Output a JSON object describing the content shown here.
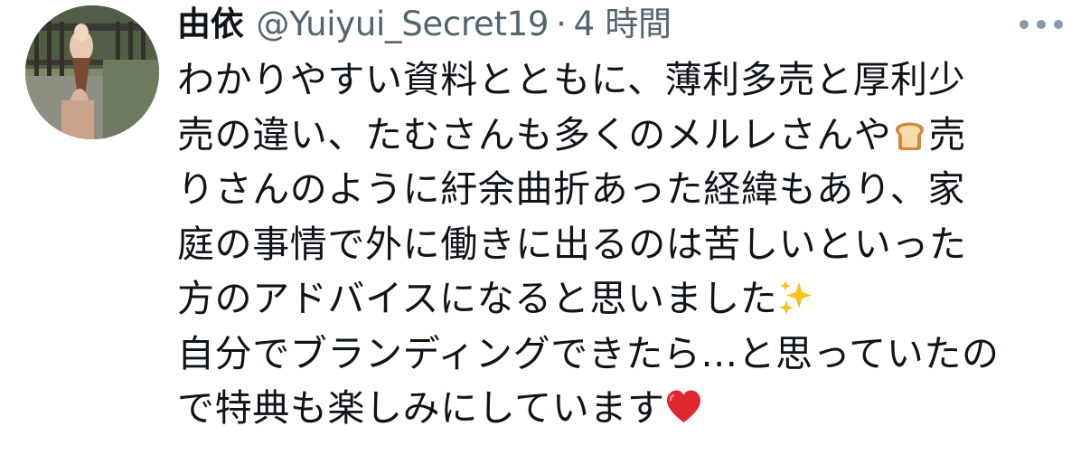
{
  "tweet": {
    "author": {
      "display_name": "由依",
      "handle": "@Yuiyui_Secret19"
    },
    "separator": "·",
    "timestamp": "4 時間",
    "lines": [
      {
        "text": "わかりやすい資料とともに、薄利多売と厚利少"
      },
      {
        "text": "売の違い、たむさんも多くのメルレさんや",
        "emoji": "bread-emoji",
        "after": "売"
      },
      {
        "text": "りさんのように紆余曲折あった経緯もあり、家"
      },
      {
        "text": "庭の事情で外に働きに出るのは苦しいといった"
      },
      {
        "text": "方のアドバイスになると思いました",
        "emoji": "sparkles-emoji",
        "after": ""
      },
      {
        "text": "自分でブランディングできたら...と思っていたの"
      },
      {
        "text": "で特典も楽しみにしています",
        "emoji": "red-heart-emoji",
        "after": ""
      }
    ]
  },
  "icons": {
    "more": "more-dots-icon",
    "avatar_photo": "soft-serve-ice-cream-photo"
  },
  "colors": {
    "text_primary": "#0f1419",
    "text_secondary": "#536471",
    "heart": "#e0262f",
    "sparkle": "#f5c518",
    "bread": "#d9a05b"
  }
}
